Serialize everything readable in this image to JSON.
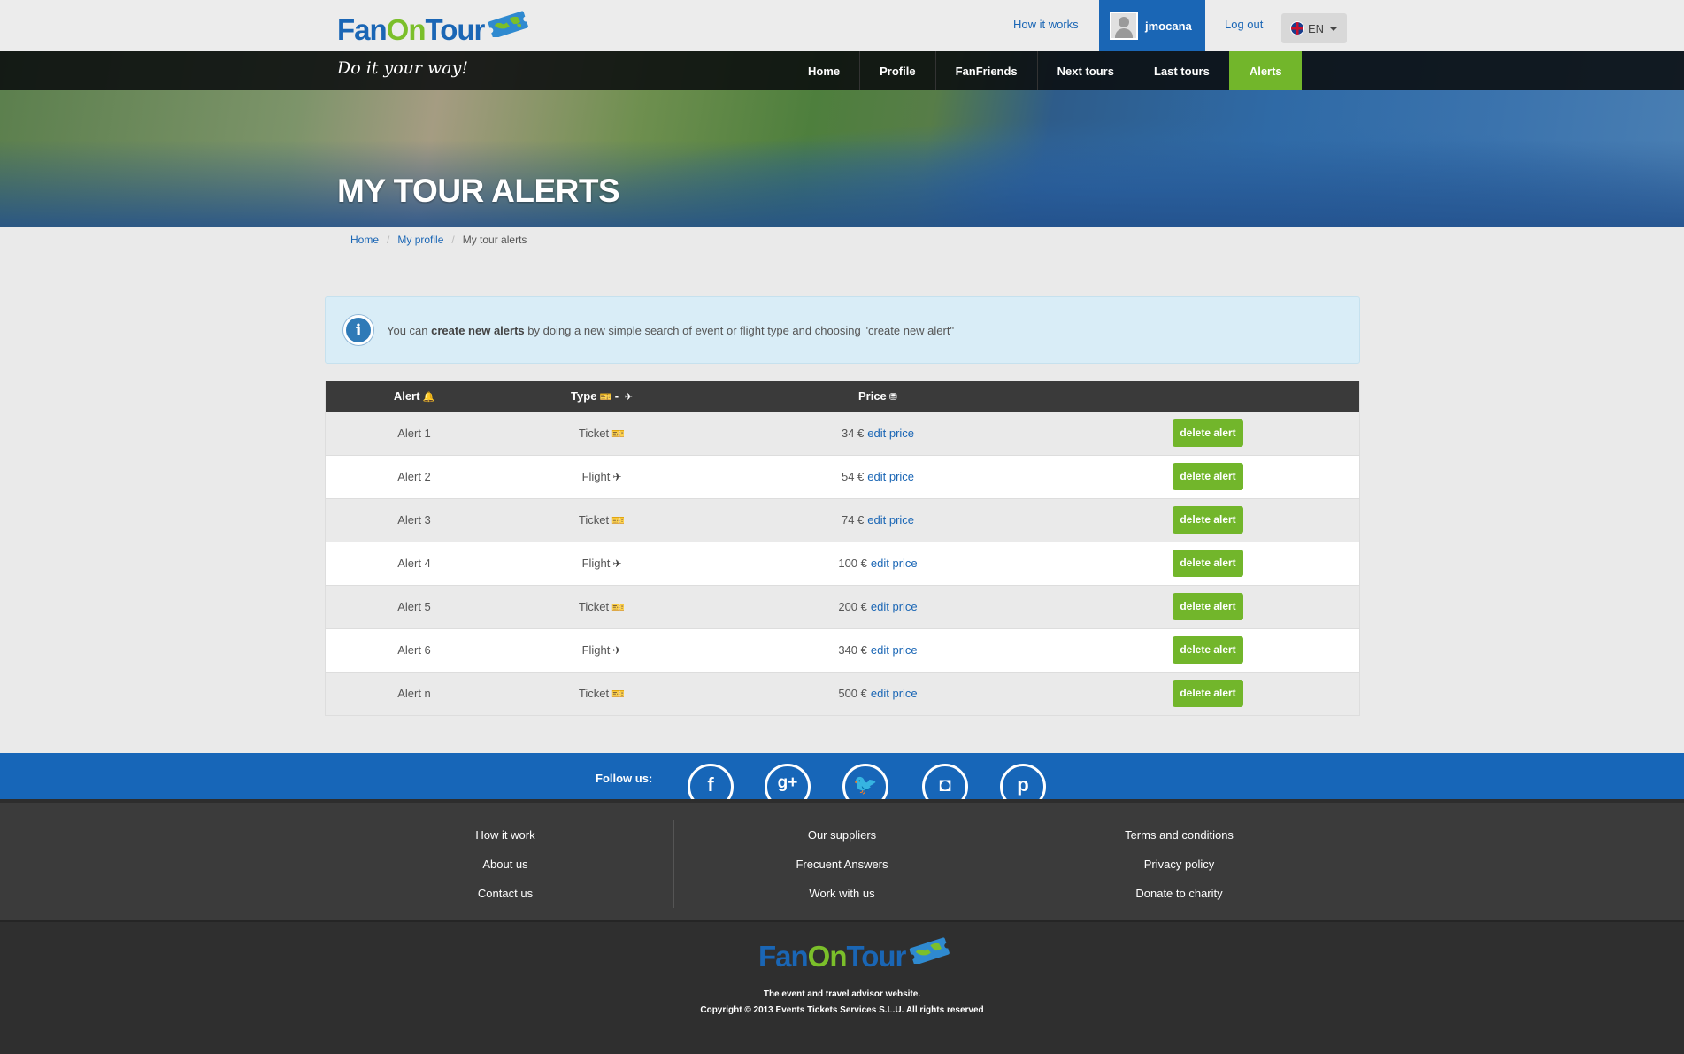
{
  "brand": {
    "logo_part1": "Fan",
    "logo_part2": "On",
    "logo_part3": "Tour",
    "tagline": "Do it your way!"
  },
  "header": {
    "how_it_works": "How it works",
    "username": "jmocana",
    "logout": "Log out",
    "language": "EN"
  },
  "nav": {
    "items": [
      {
        "label": "Home"
      },
      {
        "label": "Profile"
      },
      {
        "label": "FanFriends"
      },
      {
        "label": "Next tours"
      },
      {
        "label": "Last tours"
      },
      {
        "label": "Alerts",
        "active": true
      }
    ]
  },
  "page": {
    "title": "MY TOUR ALERTS"
  },
  "breadcrumb": {
    "home": "Home",
    "profile": "My profile",
    "current": "My tour alerts"
  },
  "info": {
    "prefix": "You can ",
    "bold": "create new alerts",
    "suffix": " by doing a new simple search of event or flight type and choosing \"create new alert\""
  },
  "table": {
    "headers": {
      "alert": "Alert",
      "type": "Type",
      "type_sep": "-",
      "price": "Price"
    },
    "edit_label": "edit price",
    "delete_label": "delete alert",
    "rows": [
      {
        "alert": "Alert 1",
        "type": "Ticket",
        "price": "34 €"
      },
      {
        "alert": "Alert 2",
        "type": "Flight",
        "price": "54 €"
      },
      {
        "alert": "Alert 3",
        "type": "Ticket",
        "price": "74 €"
      },
      {
        "alert": "Alert 4",
        "type": "Flight",
        "price": "100 €"
      },
      {
        "alert": "Alert 5",
        "type": "Ticket",
        "price": "200 €"
      },
      {
        "alert": "Alert 6",
        "type": "Flight",
        "price": "340 €"
      },
      {
        "alert": "Alert n",
        "type": "Ticket",
        "price": "500 €"
      }
    ]
  },
  "follow": {
    "label": "Follow us:",
    "networks": [
      "facebook-icon",
      "google-plus-icon",
      "twitter-icon",
      "instagram-icon",
      "pinterest-icon"
    ]
  },
  "footer": {
    "col1": [
      "How it work",
      "About us",
      "Contact us"
    ],
    "col2": [
      "Our suppliers",
      "Frecuent Answers",
      "Work with us"
    ],
    "col3": [
      "Terms and conditions",
      "Privacy policy",
      "Donate to charity"
    ],
    "tagline": "The event and travel advisor website.",
    "copyright": "Copyright © 2013 Events Tickets Services S.L.U. All rights reserved"
  },
  "colors": {
    "brand_blue": "#1a66b5",
    "brand_green": "#72b62b",
    "dark": "#3a3a3a"
  }
}
